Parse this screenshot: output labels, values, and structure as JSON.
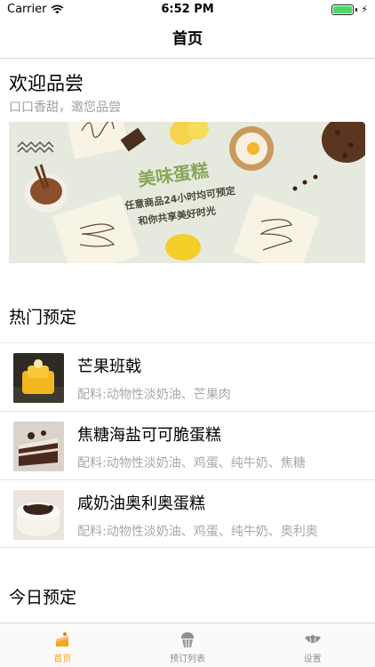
{
  "status_bar": {
    "carrier": "Carrier",
    "time": "6:52 PM"
  },
  "nav": {
    "title": "首页"
  },
  "welcome": {
    "title": "欢迎品尝",
    "subtitle": "口口香甜，邀您品尝"
  },
  "banner": {
    "headline": "美味蛋糕",
    "line1": "任意商品24小时均可预定",
    "line2": "和你共享美好时光"
  },
  "hot": {
    "title": "热门预定",
    "items": [
      {
        "name": "芒果班戟",
        "desc": "配料:动物性淡奶油、芒果肉"
      },
      {
        "name": "焦糖海盐可可脆蛋糕",
        "desc": "配料:动物性淡奶油、鸡蛋、纯牛奶、焦糖"
      },
      {
        "name": "咸奶油奥利奥蛋糕",
        "desc": "配料:动物性淡奶油、鸡蛋、纯牛奶、奥利奥"
      }
    ]
  },
  "today": {
    "title": "今日预定"
  },
  "tabs": [
    {
      "label": "首页",
      "icon": "cake-icon",
      "active": true
    },
    {
      "label": "预订列表",
      "icon": "cupcake-icon",
      "active": false
    },
    {
      "label": "设置",
      "icon": "croissant-icon",
      "active": false
    }
  ],
  "colors": {
    "accent": "#f5a623",
    "battery": "#4cd964",
    "subtitle": "#a0a0a0"
  }
}
